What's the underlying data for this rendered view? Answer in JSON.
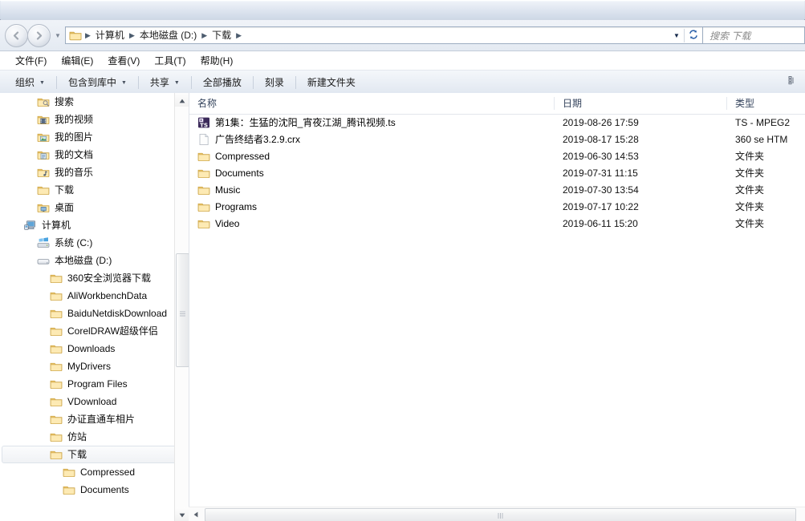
{
  "window": {
    "title": ""
  },
  "address": {
    "back_icon": "back-arrow-icon",
    "forward_icon": "forward-arrow-icon",
    "recent_dropdown_icon": "chevron-down-icon",
    "folder_icon": "folder-icon",
    "breadcrumbs": [
      "计算机",
      "本地磁盘 (D:)",
      "下载"
    ],
    "separator": "▶",
    "dropdown_icon": "chevron-down-icon",
    "refresh_icon": "refresh-icon"
  },
  "search": {
    "placeholder": "搜索 下载",
    "icon": "search-icon"
  },
  "menubar": {
    "items": [
      "文件(F)",
      "编辑(E)",
      "查看(V)",
      "工具(T)",
      "帮助(H)"
    ]
  },
  "toolbar": {
    "items": [
      {
        "label": "组织",
        "has_caret": true
      },
      {
        "label": "包含到库中",
        "has_caret": true
      },
      {
        "label": "共享",
        "has_caret": true
      },
      {
        "label": "全部播放",
        "has_caret": false
      },
      {
        "label": "刻录",
        "has_caret": false
      },
      {
        "label": "新建文件夹",
        "has_caret": false
      }
    ],
    "caret": "▼",
    "view_options_icon": "view-options-icon"
  },
  "navpane": {
    "items": [
      {
        "label": "搜索",
        "icon": "folder-search-icon",
        "indent": 2,
        "selected": false
      },
      {
        "label": "我的视频",
        "icon": "folder-video-icon",
        "indent": 2,
        "selected": false
      },
      {
        "label": "我的图片",
        "icon": "folder-pictures-icon",
        "indent": 2,
        "selected": false
      },
      {
        "label": "我的文档",
        "icon": "folder-documents-icon",
        "indent": 2,
        "selected": false
      },
      {
        "label": "我的音乐",
        "icon": "folder-music-icon",
        "indent": 2,
        "selected": false
      },
      {
        "label": "下载",
        "icon": "folder-icon",
        "indent": 2,
        "selected": false
      },
      {
        "label": "桌面",
        "icon": "folder-desktop-icon",
        "indent": 2,
        "selected": false
      },
      {
        "label": "计算机",
        "icon": "computer-icon",
        "indent": 1,
        "selected": false
      },
      {
        "label": "系统 (C:)",
        "icon": "system-drive-icon",
        "indent": 2,
        "selected": false
      },
      {
        "label": "本地磁盘 (D:)",
        "icon": "drive-icon",
        "indent": 2,
        "selected": false
      },
      {
        "label": "360安全浏览器下载",
        "icon": "folder-icon",
        "indent": 3,
        "selected": false
      },
      {
        "label": "AliWorkbenchData",
        "icon": "folder-icon",
        "indent": 3,
        "selected": false
      },
      {
        "label": "BaiduNetdiskDownload",
        "icon": "folder-icon",
        "indent": 3,
        "selected": false
      },
      {
        "label": "CorelDRAW超级伴侣",
        "icon": "folder-icon",
        "indent": 3,
        "selected": false
      },
      {
        "label": "Downloads",
        "icon": "folder-icon",
        "indent": 3,
        "selected": false
      },
      {
        "label": "MyDrivers",
        "icon": "folder-icon",
        "indent": 3,
        "selected": false
      },
      {
        "label": "Program Files",
        "icon": "folder-icon",
        "indent": 3,
        "selected": false
      },
      {
        "label": "VDownload",
        "icon": "folder-icon",
        "indent": 3,
        "selected": false
      },
      {
        "label": "办证直通车相片",
        "icon": "folder-icon",
        "indent": 3,
        "selected": false
      },
      {
        "label": "仿站",
        "icon": "folder-icon",
        "indent": 3,
        "selected": false
      },
      {
        "label": "下载",
        "icon": "folder-icon",
        "indent": 3,
        "selected": true
      },
      {
        "label": "Compressed",
        "icon": "folder-icon",
        "indent": 4,
        "selected": false
      },
      {
        "label": "Documents",
        "icon": "folder-icon",
        "indent": 4,
        "selected": false
      }
    ],
    "scrollbar": {
      "up_arrow_icon": "triangle-up-icon",
      "down_arrow_icon": "triangle-down-icon"
    }
  },
  "filelist": {
    "columns": [
      {
        "key": "name",
        "label": "名称"
      },
      {
        "key": "date",
        "label": "日期"
      },
      {
        "key": "type",
        "label": "类型"
      }
    ],
    "rows": [
      {
        "name": "第1集：生猛的沈阳_宵夜江湖_腾讯视频.ts",
        "date": "2019-08-26 17:59",
        "type": "TS - MPEG2",
        "icon": "ts-video-file-icon"
      },
      {
        "name": "广告终结者3.2.9.crx",
        "date": "2019-08-17 15:28",
        "type": "360 se HTM",
        "icon": "generic-file-icon"
      },
      {
        "name": "Compressed",
        "date": "2019-06-30 14:53",
        "type": "文件夹",
        "icon": "folder-icon"
      },
      {
        "name": "Documents",
        "date": "2019-07-31 11:15",
        "type": "文件夹",
        "icon": "folder-icon"
      },
      {
        "name": "Music",
        "date": "2019-07-30 13:54",
        "type": "文件夹",
        "icon": "folder-icon"
      },
      {
        "name": "Programs",
        "date": "2019-07-17 10:22",
        "type": "文件夹",
        "icon": "folder-icon"
      },
      {
        "name": "Video",
        "date": "2019-06-11 15:20",
        "type": "文件夹",
        "icon": "folder-icon"
      }
    ],
    "hscrollbar": {
      "left_arrow_icon": "triangle-left-icon"
    }
  },
  "colors": {
    "column_header_text": "#34435c",
    "selection_bg": "#f0f2f5",
    "folder_yellow": "#ffd27a",
    "ts_icon_bg": "#3b2a5a"
  }
}
